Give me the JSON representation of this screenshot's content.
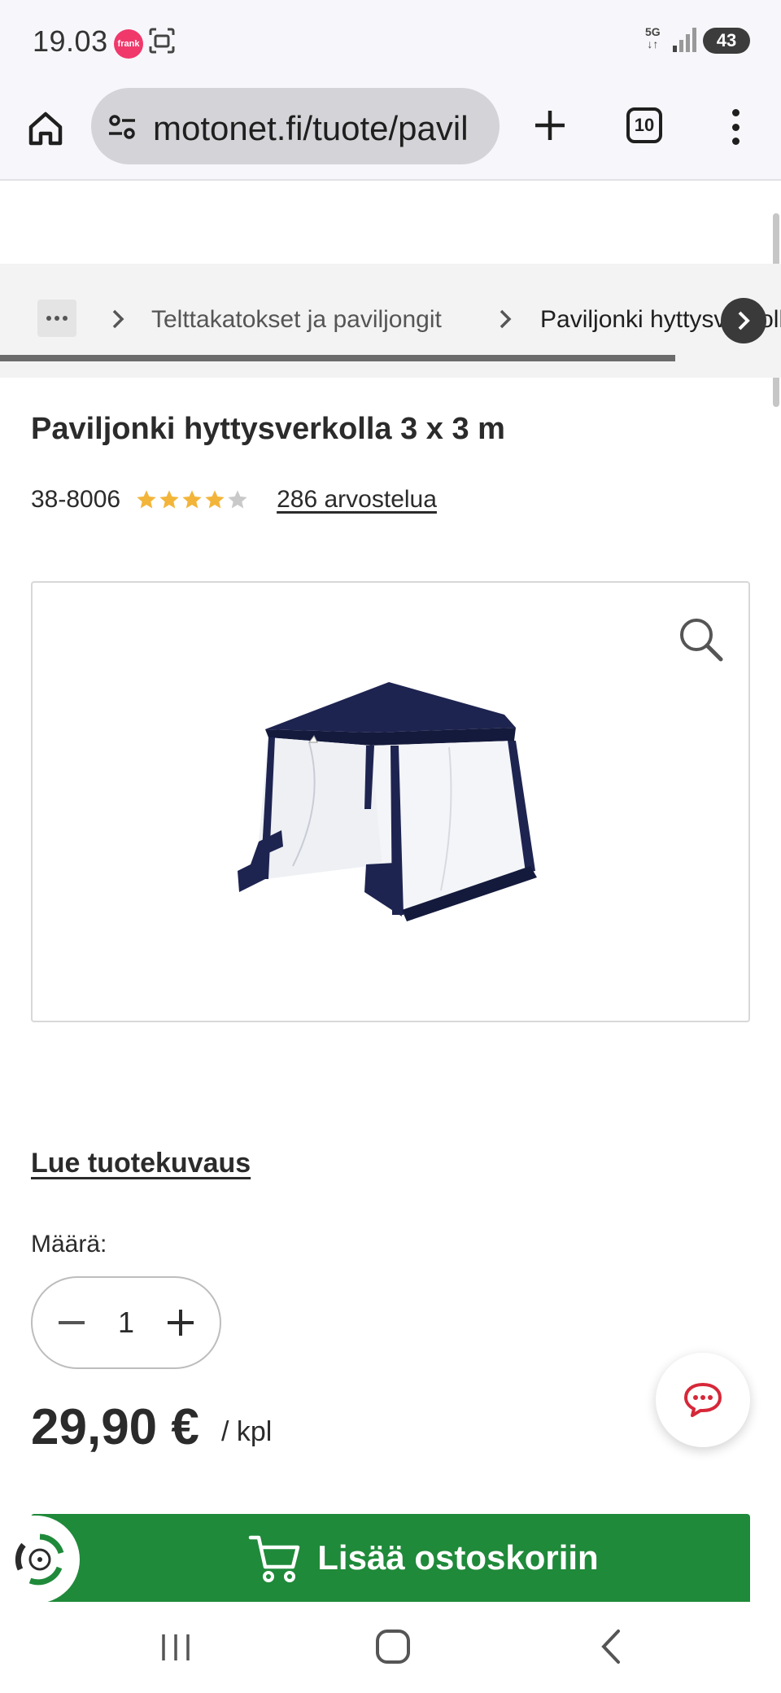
{
  "status_bar": {
    "time": "19.03",
    "app_badge": "frank",
    "network": "5G",
    "battery": "43"
  },
  "browser": {
    "url": "motonet.fi/tuote/pavil",
    "tab_count": "10"
  },
  "breadcrumb": {
    "items": [
      "Telttakatokset ja paviljongit",
      "Paviljonki hyttysverkolla"
    ],
    "scroll_progress": 0.865
  },
  "product": {
    "title": "Paviljonki hyttysverkolla 3 x 3 m",
    "sku": "38-8006",
    "rating": 4,
    "rating_max": 5,
    "reviews_label": "286 arvostelua",
    "description_link": "Lue tuotekuvaus",
    "quantity_label": "Määrä:",
    "quantity": "1",
    "price": "29,90 €",
    "price_unit": "/ kpl",
    "add_to_cart_label": "Lisää ostoskoriin"
  },
  "colors": {
    "accent_green": "#1f8a3a",
    "star_filled": "#f2b53a",
    "star_empty": "#c9c9c9",
    "chat_red": "#d62839"
  }
}
